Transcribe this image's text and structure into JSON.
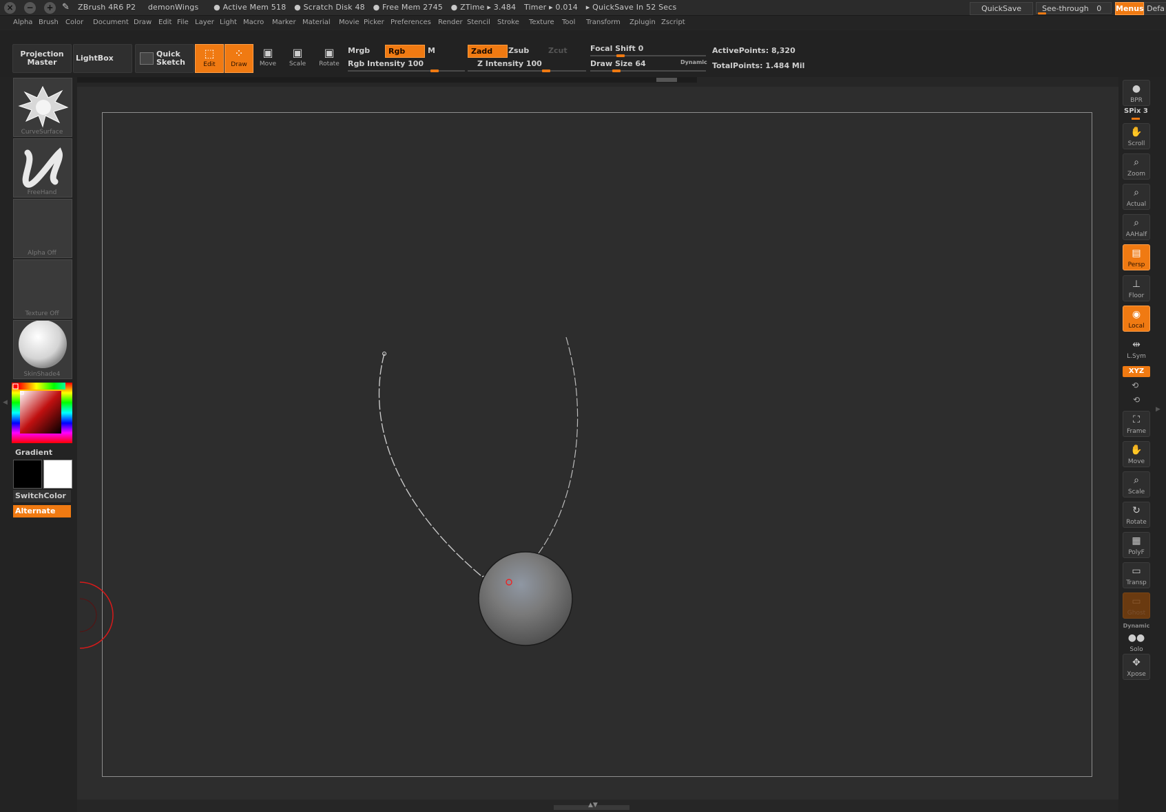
{
  "titlebar": {
    "app": "ZBrush 4R6 P2",
    "document": "demonWings",
    "active_mem": "● Active Mem 518",
    "scratch_disk": "● Scratch Disk 48",
    "free_mem": "● Free Mem 2745",
    "ztime": "● ZTime ▸ 3.484",
    "timer": "Timer ▸ 0.014",
    "quicksave_in": "▸ QuickSave In 52 Secs",
    "quicksave_button": "QuickSave",
    "see_through_label": "See-through",
    "see_through_value": "0",
    "menus_button": "Menus",
    "default_button": "Defa"
  },
  "menubar": [
    "Alpha",
    "Brush",
    "Color",
    "Document",
    "Draw",
    "Edit",
    "File",
    "Layer",
    "Light",
    "Macro",
    "Marker",
    "Material",
    "Movie",
    "Picker",
    "Preferences",
    "Render",
    "Stencil",
    "Stroke",
    "Texture",
    "Tool",
    "Transform",
    "Zplugin",
    "Zscript"
  ],
  "toolbar": {
    "projection_master": "Projection Master",
    "lightbox": "LightBox",
    "quick_sketch": "Quick Sketch",
    "edit": "Edit",
    "draw": "Draw",
    "move": "Move",
    "scale": "Scale",
    "rotate": "Rotate",
    "mrgb": "Mrgb",
    "rgb": "Rgb",
    "m": "M",
    "zadd": "Zadd",
    "zsub": "Zsub",
    "zcut": "Zcut",
    "rgb_intensity": "Rgb Intensity 100",
    "z_intensity": "Z Intensity 100",
    "focal_shift": "Focal Shift 0",
    "draw_size": "Draw Size 64",
    "dynamic": "Dynamic",
    "active_points": "ActivePoints: 8,320",
    "total_points": "TotalPoints: 1.484 Mil",
    "rgb_intensity_value": 100,
    "z_intensity_value": 100,
    "focal_shift_value": 0,
    "draw_size_value": 64
  },
  "leftshelf": {
    "brush_caption": "CurveSurface",
    "stroke_caption": "FreeHand",
    "alpha_caption": "Alpha Off",
    "texture_caption": "Texture Off",
    "material_caption": "SkinShade4",
    "gradient": "Gradient",
    "switchcolor": "SwitchColor",
    "alternate": "Alternate"
  },
  "rightshelf": {
    "bpr": "BPR",
    "spix": "SPix 3",
    "scroll": "Scroll",
    "zoom": "Zoom",
    "actual": "Actual",
    "aahalf": "AAHalf",
    "persp": "Persp",
    "floor": "Floor",
    "local": "Local",
    "lsym": "L.Sym",
    "xyz": "XYZ",
    "frame": "Frame",
    "move": "Move",
    "scale": "Scale",
    "rotate": "Rotate",
    "polyf": "PolyF",
    "transp": "Transp",
    "ghost": "Ghost",
    "dynamic": "Dynamic",
    "solo": "Solo",
    "xpose": "Xpose"
  },
  "colors": {
    "accent": "#f07a12",
    "background": "#262626",
    "canvas": "#2d2d2d",
    "frame": "#8f8f8f"
  }
}
